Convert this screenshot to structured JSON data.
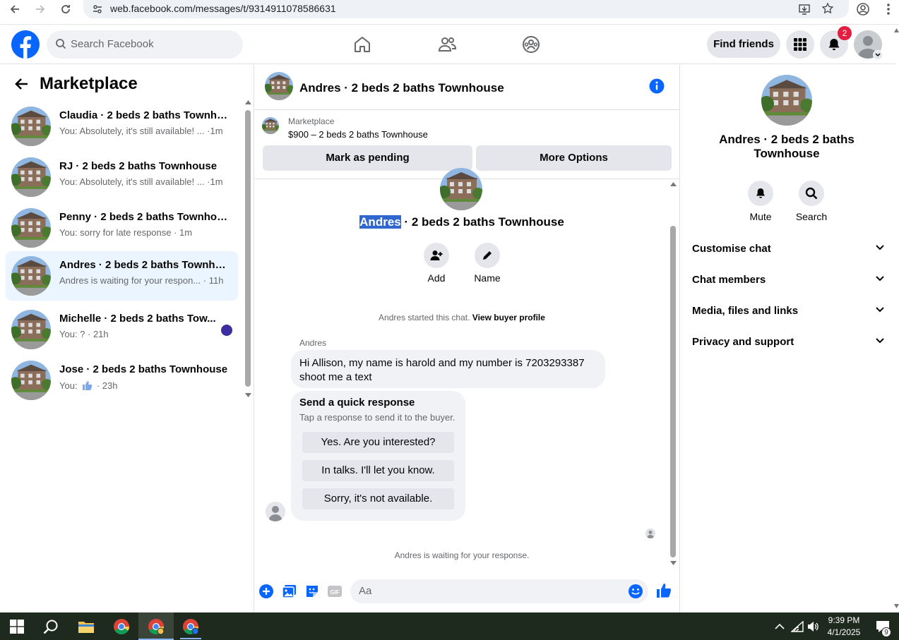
{
  "browser": {
    "url": "web.facebook.com/messages/t/9314911078586631"
  },
  "topbar": {
    "search_placeholder": "Search Facebook",
    "find_friends_label": "Find friends",
    "notifications_count": "2"
  },
  "sidebar": {
    "title": "Marketplace",
    "conversations": [
      {
        "name": "Claudia · 2 beds 2 baths Townho...",
        "preview": "You: Absolutely, it's still available! ... ·1m"
      },
      {
        "name": "RJ · 2 beds 2 baths Townhouse",
        "preview": "You: Absolutely, it's still available! ... ·1m"
      },
      {
        "name": "Penny · 2 beds 2 baths Townhouse",
        "preview": "You: sorry for late response · 1m"
      },
      {
        "name": "Andres · 2 beds 2 baths Townho...",
        "preview": "Andres is waiting for your respon... · 11h"
      },
      {
        "name": "Michelle · 2 beds 2 baths Tow...",
        "preview": "You: ? · 21h"
      },
      {
        "name": "Jose · 2 beds 2 baths Townhouse",
        "preview_prefix": "You:",
        "preview_suffix": "· 23h"
      }
    ]
  },
  "chat": {
    "header_title": "Andres · 2 beds 2 baths Townhouse",
    "listing_label": "Marketplace",
    "listing_price": "$900 – 2 beds 2 baths Townhouse",
    "mark_pending_label": "Mark as pending",
    "more_options_label": "More Options",
    "intro_name_selected": "Andres",
    "intro_rest": " · 2 beds 2 baths Townhouse",
    "action_add_label": "Add",
    "action_name_label": "Name",
    "started_text": "Andres started this chat.",
    "view_buyer_label": "View buyer profile",
    "sender_name": "Andres",
    "message_text": "Hi Allison, my name is harold and my number is 7203293387 shoot me a text",
    "quick_title": "Send a quick response",
    "quick_subtitle": "Tap a response to send it to the buyer.",
    "quick_responses": [
      "Yes. Are you interested?",
      "In talks. I'll let you know.",
      "Sorry, it's not available."
    ],
    "waiting_text": "Andres is waiting for your response.",
    "composer_placeholder": "Aa"
  },
  "details": {
    "title": "Andres · 2 beds 2 baths Townhouse",
    "mute_label": "Mute",
    "search_label": "Search",
    "sections": [
      "Customise chat",
      "Chat members",
      "Media, files and links",
      "Privacy and support"
    ]
  },
  "taskbar": {
    "time": "9:39 PM",
    "date": "4/1/2025",
    "notification_count": "9"
  },
  "colors": {
    "brand": "#0866ff",
    "active_row": "#ebf5ff",
    "badge": "#e41e3f"
  }
}
